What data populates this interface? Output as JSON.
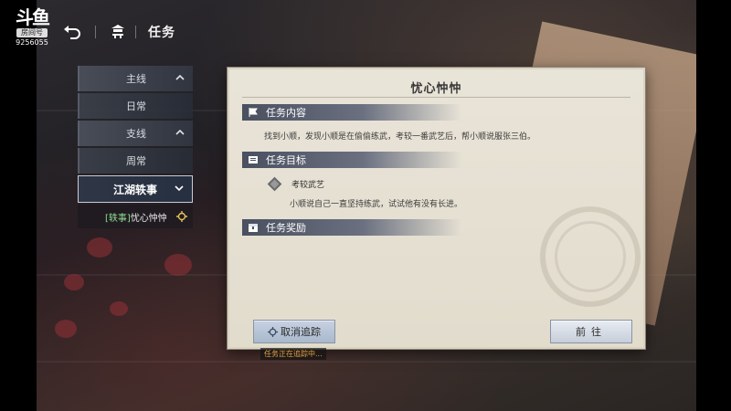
{
  "stream_overlay": {
    "logo_text": "斗鱼",
    "room_label": "房间号",
    "room_number": "9256055"
  },
  "topbar": {
    "back_icon": "return-arrow-icon",
    "home_icon": "pavilion-icon",
    "title": "任务"
  },
  "nav": {
    "items": [
      {
        "label": "主线",
        "kind": "category",
        "icon": "chevron-up-icon"
      },
      {
        "label": "日常",
        "kind": "sub"
      },
      {
        "label": "支线",
        "kind": "category",
        "icon": "chevron-up-icon"
      },
      {
        "label": "周常",
        "kind": "sub"
      },
      {
        "label": "江湖轶事",
        "kind": "category-active",
        "icon": "chevron-down-icon"
      }
    ],
    "quest_entry": {
      "tag": "[轶事]",
      "name": "忧心忡忡",
      "icon": "tracking-crosshair-icon"
    }
  },
  "dialog": {
    "title": "忧心忡忡",
    "sections": {
      "content": {
        "heading": "任务内容",
        "icon": "flag-icon",
        "text": "找到小顺，发现小顺是在偷偷练武，考较一番武艺后，帮小顺说服张三伯。"
      },
      "target": {
        "heading": "任务目标",
        "icon": "scroll-icon",
        "goal_title": "考较武艺",
        "goal_desc": "小顺说自己一直坚持练武，试试他有没有长进。"
      },
      "reward": {
        "heading": "任务奖励",
        "icon": "chest-icon"
      }
    },
    "buttons": {
      "cancel_track": "取消追踪",
      "go": "前往"
    },
    "tracking_status": "任务正在追踪中..."
  },
  "colors": {
    "dialog_bg": "#e9e4d8",
    "section_header": "#4a5060",
    "tag_green": "#8fd98f",
    "status_orange": "#e8a040"
  }
}
